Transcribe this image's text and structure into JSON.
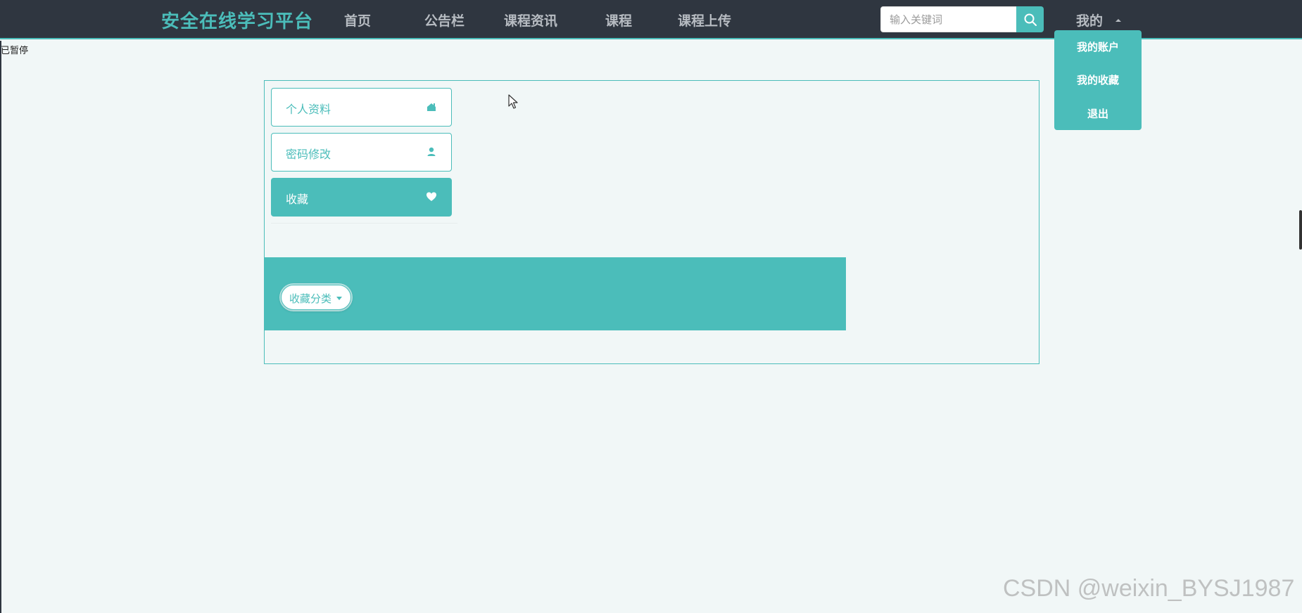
{
  "brand": "安全在线学习平台",
  "nav": {
    "items": [
      {
        "label": "首页"
      },
      {
        "label": "公告栏"
      },
      {
        "label": "课程资讯"
      },
      {
        "label": "课程"
      },
      {
        "label": "课程上传"
      }
    ]
  },
  "search": {
    "placeholder": "输入关键词",
    "value": "",
    "icon": "search-icon"
  },
  "user_menu": {
    "label": "我的",
    "items": [
      {
        "label": "我的账户"
      },
      {
        "label": "我的收藏"
      },
      {
        "label": "退出"
      }
    ]
  },
  "corner_text": "已暂停",
  "sidebar": {
    "items": [
      {
        "label": "个人资料",
        "icon": "home-icon",
        "active": false
      },
      {
        "label": "密码修改",
        "icon": "user-icon",
        "active": false
      },
      {
        "label": "收藏",
        "icon": "heart-icon",
        "active": true
      }
    ]
  },
  "favorites": {
    "category_button": "收藏分类"
  },
  "watermark": "CSDN @weixin_BYSJ1987",
  "colors": {
    "accent": "#4bbdba",
    "topbar": "#2f3640",
    "background": "#f1f7f7"
  }
}
